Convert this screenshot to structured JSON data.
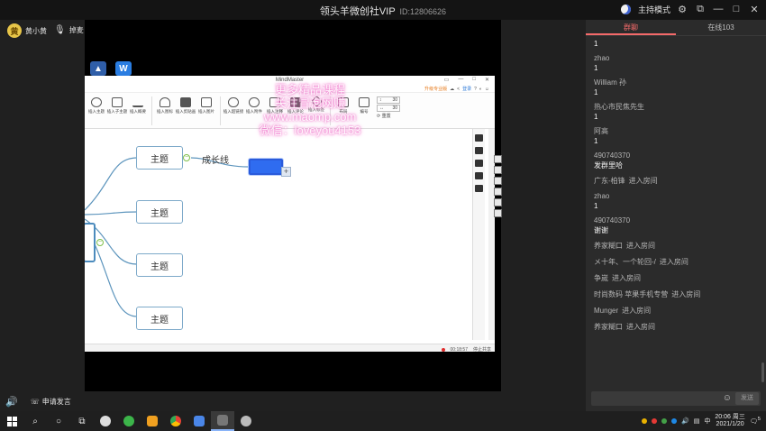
{
  "window": {
    "title": "领头羊微创社VIP",
    "room_id": "ID:12806626",
    "host_mode_label": "主持模式",
    "controls": [
      "⚙",
      "⧉",
      "—",
      "□",
      "✕"
    ]
  },
  "stage": {
    "users": [
      {
        "name": "黄小黄",
        "avatar_letter": "黄"
      },
      {
        "name": "掉麦"
      }
    ],
    "speaker_glyph": "🔊",
    "request_speak_label": "申请发言"
  },
  "mindmaster": {
    "title": "MindMaster",
    "title_controls": [
      "▭",
      "—",
      "□",
      "✕"
    ],
    "menu_right": [
      "升级专业版",
      "☁",
      "<",
      "登录",
      "?",
      "◐",
      "☺"
    ],
    "ribbon": [
      {
        "label": "插入主题"
      },
      {
        "label": "插入子主题"
      },
      {
        "label": "插入概要"
      },
      {
        "label": "插入图标"
      },
      {
        "label": "插入剪贴画"
      },
      {
        "label": "插入图片"
      },
      {
        "label": "插入超链接"
      },
      {
        "label": "插入附件"
      },
      {
        "label": "插入注释"
      },
      {
        "label": "插入评论"
      },
      {
        "label": "插入标签"
      },
      {
        "label": "布局"
      },
      {
        "label": "编号"
      }
    ],
    "spin_values": [
      "30",
      "30"
    ],
    "reset_label": "重置",
    "nodes": [
      "主题",
      "主题",
      "主题",
      "主题"
    ],
    "edge_label": "成长线",
    "status_time": "00:18:57",
    "status_button": "停止共享"
  },
  "watermark": {
    "line1": "更多精品课程",
    "line2": "关注冒泡网赚",
    "line3": "www.maomp.com",
    "line4": "微信：loveyou4153"
  },
  "chat": {
    "tabs": [
      {
        "label": "群聊",
        "active": true
      },
      {
        "label": "在线103",
        "active": false
      }
    ],
    "messages": [
      {
        "type": "text",
        "text": "1"
      },
      {
        "type": "msg",
        "name": "zhao",
        "text": "1"
      },
      {
        "type": "msg",
        "name": "William 孙",
        "text": "1"
      },
      {
        "type": "msg",
        "name": "热心市民焦先生",
        "text": "1"
      },
      {
        "type": "msg",
        "name": "阿高",
        "text": "1"
      },
      {
        "type": "msg",
        "name": "490740370",
        "text": "发群里哈"
      },
      {
        "type": "enter",
        "name": "广东-柏锋",
        "action": "进入房间"
      },
      {
        "type": "msg",
        "name": "zhao",
        "text": "1"
      },
      {
        "type": "msg",
        "name": "490740370",
        "text": "谢谢"
      },
      {
        "type": "enter",
        "name": "养家糊口",
        "action": "进入房间"
      },
      {
        "type": "enter",
        "name": "メ十年、一个轮回-/",
        "action": "进入房间"
      },
      {
        "type": "enter",
        "name": "争嵗",
        "action": "进入房间"
      },
      {
        "type": "enter",
        "name": "时尚数码  苹果手机专营",
        "action": "进入房间"
      },
      {
        "type": "enter",
        "name": "Munger",
        "action": "进入房间"
      },
      {
        "type": "enter",
        "name": "养家糊口",
        "action": "进入房间"
      }
    ],
    "send_label": "发送"
  },
  "taskbar": {
    "tray_lang": "中",
    "time": "20:06 周三",
    "date": "2021/1/20",
    "notify_count": "5"
  }
}
